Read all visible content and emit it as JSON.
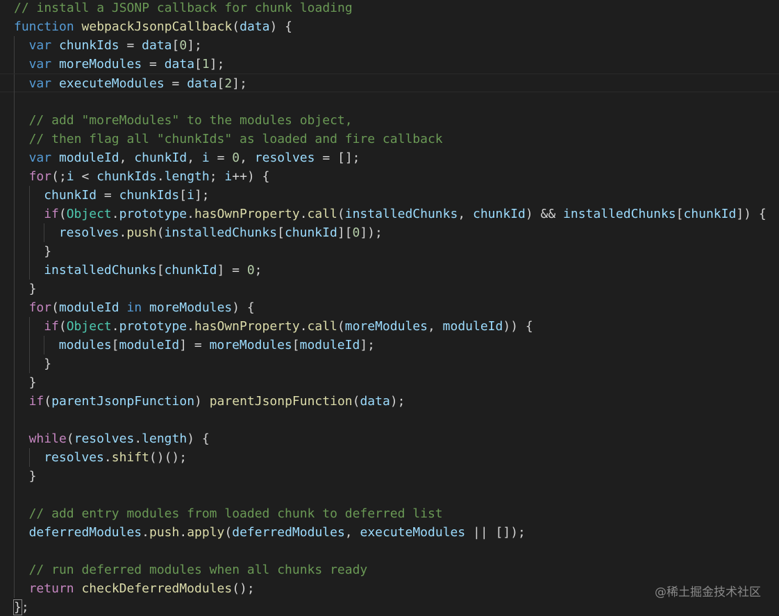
{
  "editor": {
    "language": "javascript",
    "theme_colors": {
      "background": "#1e1e1e",
      "keyword": "#569cd6",
      "control": "#c586c0",
      "function": "#dcdcaa",
      "variable": "#9cdcfe",
      "number": "#b5cea8",
      "string": "#ce9178",
      "comment": "#6a9955",
      "type": "#4ec9b0",
      "punctuation": "#d4d4d4"
    },
    "lines": [
      {
        "indent": 0,
        "tokens": [
          [
            "com",
            "// install a JSONP callback for chunk loading"
          ]
        ]
      },
      {
        "indent": 0,
        "tokens": [
          [
            "kw",
            "function"
          ],
          [
            "p",
            " "
          ],
          [
            "fn",
            "webpackJsonpCallback"
          ],
          [
            "p",
            "("
          ],
          [
            "var",
            "data"
          ],
          [
            "p",
            ") {"
          ]
        ]
      },
      {
        "indent": 1,
        "tokens": [
          [
            "kw",
            "var"
          ],
          [
            "p",
            " "
          ],
          [
            "var",
            "chunkIds"
          ],
          [
            "p",
            " = "
          ],
          [
            "var",
            "data"
          ],
          [
            "p",
            "["
          ],
          [
            "num",
            "0"
          ],
          [
            "p",
            "];"
          ]
        ]
      },
      {
        "indent": 1,
        "tokens": [
          [
            "kw",
            "var"
          ],
          [
            "p",
            " "
          ],
          [
            "var",
            "moreModules"
          ],
          [
            "p",
            " = "
          ],
          [
            "var",
            "data"
          ],
          [
            "p",
            "["
          ],
          [
            "num",
            "1"
          ],
          [
            "p",
            "];"
          ]
        ]
      },
      {
        "indent": 1,
        "current": true,
        "tokens": [
          [
            "kw",
            "var"
          ],
          [
            "p",
            " "
          ],
          [
            "var",
            "executeModules"
          ],
          [
            "p",
            " = "
          ],
          [
            "var",
            "data"
          ],
          [
            "p",
            "["
          ],
          [
            "num",
            "2"
          ],
          [
            "p",
            "];"
          ]
        ]
      },
      {
        "indent": 1,
        "tokens": []
      },
      {
        "indent": 1,
        "tokens": [
          [
            "com",
            "// add \"moreModules\" to the modules object,"
          ]
        ]
      },
      {
        "indent": 1,
        "tokens": [
          [
            "com",
            "// then flag all \"chunkIds\" as loaded and fire callback"
          ]
        ]
      },
      {
        "indent": 1,
        "tokens": [
          [
            "kw",
            "var"
          ],
          [
            "p",
            " "
          ],
          [
            "var",
            "moduleId"
          ],
          [
            "p",
            ", "
          ],
          [
            "var",
            "chunkId"
          ],
          [
            "p",
            ", "
          ],
          [
            "var",
            "i"
          ],
          [
            "p",
            " = "
          ],
          [
            "num",
            "0"
          ],
          [
            "p",
            ", "
          ],
          [
            "var",
            "resolves"
          ],
          [
            "p",
            " = [];"
          ]
        ]
      },
      {
        "indent": 1,
        "tokens": [
          [
            "ctrl",
            "for"
          ],
          [
            "p",
            "(;"
          ],
          [
            "var",
            "i"
          ],
          [
            "p",
            " < "
          ],
          [
            "var",
            "chunkIds"
          ],
          [
            "p",
            "."
          ],
          [
            "var",
            "length"
          ],
          [
            "p",
            "; "
          ],
          [
            "var",
            "i"
          ],
          [
            "p",
            "++) {"
          ]
        ]
      },
      {
        "indent": 2,
        "tokens": [
          [
            "var",
            "chunkId"
          ],
          [
            "p",
            " = "
          ],
          [
            "var",
            "chunkIds"
          ],
          [
            "p",
            "["
          ],
          [
            "var",
            "i"
          ],
          [
            "p",
            "];"
          ]
        ]
      },
      {
        "indent": 2,
        "tokens": [
          [
            "ctrl",
            "if"
          ],
          [
            "p",
            "("
          ],
          [
            "type",
            "Object"
          ],
          [
            "p",
            "."
          ],
          [
            "var",
            "prototype"
          ],
          [
            "p",
            "."
          ],
          [
            "fn",
            "hasOwnProperty"
          ],
          [
            "p",
            "."
          ],
          [
            "fn",
            "call"
          ],
          [
            "p",
            "("
          ],
          [
            "var",
            "installedChunks"
          ],
          [
            "p",
            ", "
          ],
          [
            "var",
            "chunkId"
          ],
          [
            "p",
            ") && "
          ],
          [
            "var",
            "installedChunks"
          ],
          [
            "p",
            "["
          ],
          [
            "var",
            "chunkId"
          ],
          [
            "p",
            "]) {"
          ]
        ]
      },
      {
        "indent": 3,
        "tokens": [
          [
            "var",
            "resolves"
          ],
          [
            "p",
            "."
          ],
          [
            "fn",
            "push"
          ],
          [
            "p",
            "("
          ],
          [
            "var",
            "installedChunks"
          ],
          [
            "p",
            "["
          ],
          [
            "var",
            "chunkId"
          ],
          [
            "p",
            "]["
          ],
          [
            "num",
            "0"
          ],
          [
            "p",
            "]);"
          ]
        ]
      },
      {
        "indent": 2,
        "tokens": [
          [
            "p",
            "}"
          ]
        ]
      },
      {
        "indent": 2,
        "tokens": [
          [
            "var",
            "installedChunks"
          ],
          [
            "p",
            "["
          ],
          [
            "var",
            "chunkId"
          ],
          [
            "p",
            "] = "
          ],
          [
            "num",
            "0"
          ],
          [
            "p",
            ";"
          ]
        ]
      },
      {
        "indent": 1,
        "tokens": [
          [
            "p",
            "}"
          ]
        ]
      },
      {
        "indent": 1,
        "tokens": [
          [
            "ctrl",
            "for"
          ],
          [
            "p",
            "("
          ],
          [
            "var",
            "moduleId"
          ],
          [
            "p",
            " "
          ],
          [
            "kw",
            "in"
          ],
          [
            "p",
            " "
          ],
          [
            "var",
            "moreModules"
          ],
          [
            "p",
            ") {"
          ]
        ]
      },
      {
        "indent": 2,
        "tokens": [
          [
            "ctrl",
            "if"
          ],
          [
            "p",
            "("
          ],
          [
            "type",
            "Object"
          ],
          [
            "p",
            "."
          ],
          [
            "var",
            "prototype"
          ],
          [
            "p",
            "."
          ],
          [
            "fn",
            "hasOwnProperty"
          ],
          [
            "p",
            "."
          ],
          [
            "fn",
            "call"
          ],
          [
            "p",
            "("
          ],
          [
            "var",
            "moreModules"
          ],
          [
            "p",
            ", "
          ],
          [
            "var",
            "moduleId"
          ],
          [
            "p",
            ")) {"
          ]
        ]
      },
      {
        "indent": 3,
        "tokens": [
          [
            "var",
            "modules"
          ],
          [
            "p",
            "["
          ],
          [
            "var",
            "moduleId"
          ],
          [
            "p",
            "] = "
          ],
          [
            "var",
            "moreModules"
          ],
          [
            "p",
            "["
          ],
          [
            "var",
            "moduleId"
          ],
          [
            "p",
            "];"
          ]
        ]
      },
      {
        "indent": 2,
        "tokens": [
          [
            "p",
            "}"
          ]
        ]
      },
      {
        "indent": 1,
        "tokens": [
          [
            "p",
            "}"
          ]
        ]
      },
      {
        "indent": 1,
        "tokens": [
          [
            "ctrl",
            "if"
          ],
          [
            "p",
            "("
          ],
          [
            "var",
            "parentJsonpFunction"
          ],
          [
            "p",
            ") "
          ],
          [
            "fn",
            "parentJsonpFunction"
          ],
          [
            "p",
            "("
          ],
          [
            "var",
            "data"
          ],
          [
            "p",
            ");"
          ]
        ]
      },
      {
        "indent": 1,
        "tokens": []
      },
      {
        "indent": 1,
        "tokens": [
          [
            "ctrl",
            "while"
          ],
          [
            "p",
            "("
          ],
          [
            "var",
            "resolves"
          ],
          [
            "p",
            "."
          ],
          [
            "var",
            "length"
          ],
          [
            "p",
            ") {"
          ]
        ]
      },
      {
        "indent": 2,
        "tokens": [
          [
            "var",
            "resolves"
          ],
          [
            "p",
            "."
          ],
          [
            "fn",
            "shift"
          ],
          [
            "p",
            "()();"
          ]
        ]
      },
      {
        "indent": 1,
        "tokens": [
          [
            "p",
            "}"
          ]
        ]
      },
      {
        "indent": 1,
        "tokens": []
      },
      {
        "indent": 1,
        "tokens": [
          [
            "com",
            "// add entry modules from loaded chunk to deferred list"
          ]
        ]
      },
      {
        "indent": 1,
        "tokens": [
          [
            "var",
            "deferredModules"
          ],
          [
            "p",
            "."
          ],
          [
            "fn",
            "push"
          ],
          [
            "p",
            "."
          ],
          [
            "fn",
            "apply"
          ],
          [
            "p",
            "("
          ],
          [
            "var",
            "deferredModules"
          ],
          [
            "p",
            ", "
          ],
          [
            "var",
            "executeModules"
          ],
          [
            "p",
            " || []);"
          ]
        ]
      },
      {
        "indent": 1,
        "tokens": []
      },
      {
        "indent": 1,
        "tokens": [
          [
            "com",
            "// run deferred modules when all chunks ready"
          ]
        ]
      },
      {
        "indent": 1,
        "tokens": [
          [
            "ctrl",
            "return"
          ],
          [
            "p",
            " "
          ],
          [
            "fn",
            "checkDeferredModules"
          ],
          [
            "p",
            "();"
          ]
        ]
      },
      {
        "indent": 0,
        "tokens": [
          [
            "brace",
            "}"
          ],
          [
            "p",
            ";"
          ]
        ]
      }
    ]
  },
  "watermark": "@稀土掘金技术社区"
}
